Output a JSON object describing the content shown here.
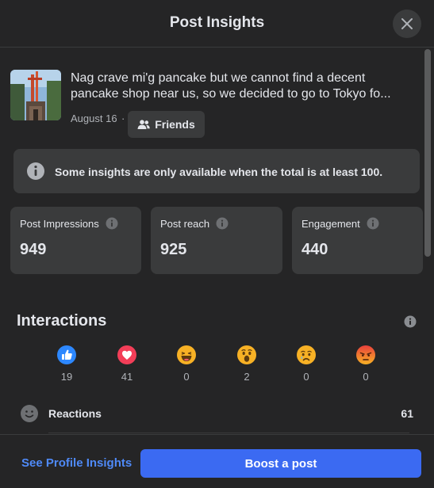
{
  "header": {
    "title": "Post Insights",
    "close_icon": "close-icon"
  },
  "post": {
    "text_line1": "Nag crave mi'g pancake but we cannot find a decent",
    "text_line2": "pancake shop near us, so we decided to go to Tokyo fo...",
    "date": "August 16",
    "separator": "·",
    "audience": "Friends",
    "audience_icon": "friends-icon"
  },
  "notice": {
    "icon": "info-icon",
    "text": "Some insights are only available when the total is at least 100."
  },
  "stats": [
    {
      "label": "Post Impressions",
      "value": "949"
    },
    {
      "label": "Post reach",
      "value": "925"
    },
    {
      "label": "Engagement",
      "value": "440"
    }
  ],
  "interactions": {
    "title": "Interactions",
    "reactions": [
      {
        "type": "like",
        "icon": "like-icon",
        "count": "19"
      },
      {
        "type": "love",
        "icon": "love-icon",
        "count": "41"
      },
      {
        "type": "haha",
        "icon": "haha-icon",
        "count": "0"
      },
      {
        "type": "wow",
        "icon": "wow-icon",
        "count": "2"
      },
      {
        "type": "sad",
        "icon": "sad-icon",
        "count": "0"
      },
      {
        "type": "angry",
        "icon": "angry-icon",
        "count": "0"
      }
    ],
    "reactions_row": {
      "label": "Reactions",
      "total": "61",
      "icon": "smiley-icon"
    }
  },
  "footer": {
    "profile_link": "See Profile Insights",
    "boost_label": "Boost a post"
  },
  "colors": {
    "background": "#252526",
    "card": "#3a3b3c",
    "accent": "#3b6af2",
    "link": "#4f8af8"
  }
}
